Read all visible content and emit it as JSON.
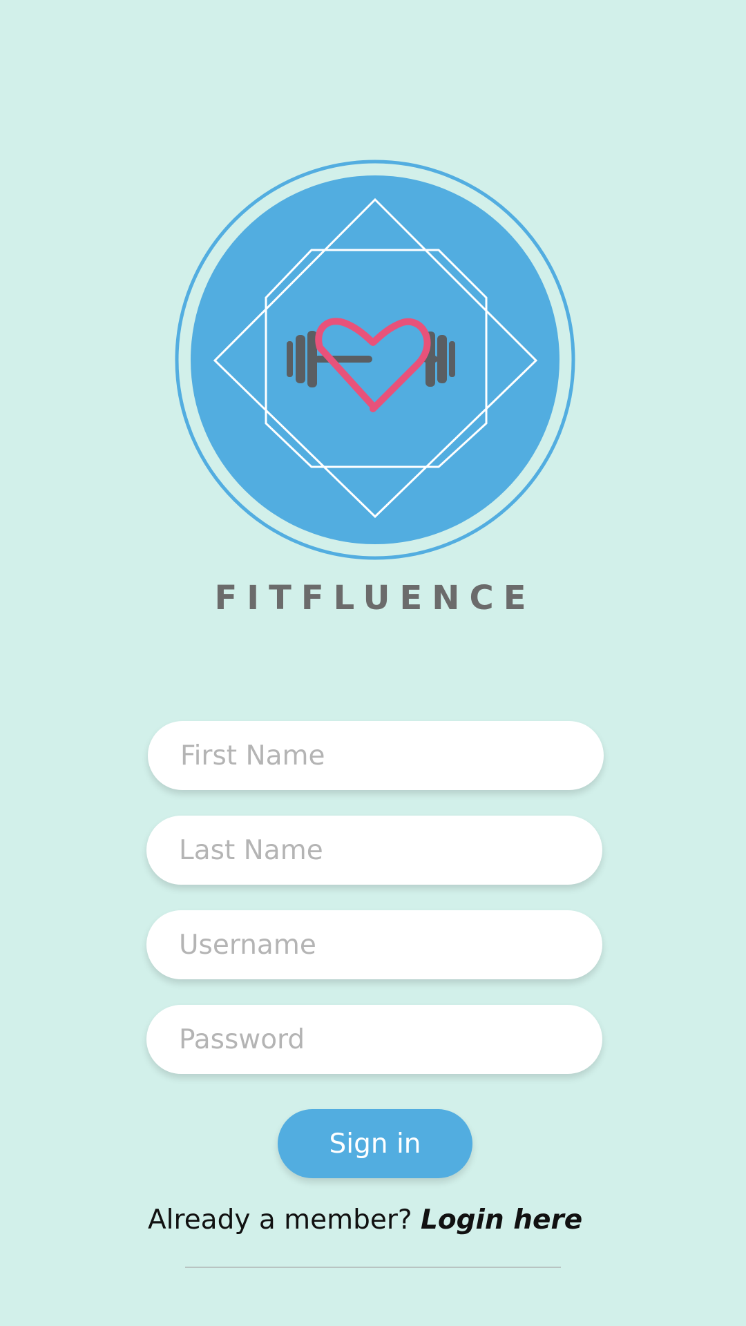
{
  "app": {
    "brand_name": "FITFLUENCE",
    "colors": {
      "background": "#d2f0ea",
      "accent": "#52ade0",
      "heart": "#e8527a",
      "dumbbell": "#5a5e62",
      "brand_text": "#6b6b6b"
    },
    "logo_icons": [
      "dumbbell-icon",
      "heart-icon"
    ]
  },
  "form": {
    "first_name": {
      "placeholder": "First Name",
      "value": ""
    },
    "last_name": {
      "placeholder": "Last Name",
      "value": ""
    },
    "username": {
      "placeholder": "Username",
      "value": ""
    },
    "password": {
      "placeholder": "Password",
      "value": ""
    },
    "submit_label": "Sign in"
  },
  "footer": {
    "prompt": "Already a member? ",
    "link_label": "Login here"
  }
}
